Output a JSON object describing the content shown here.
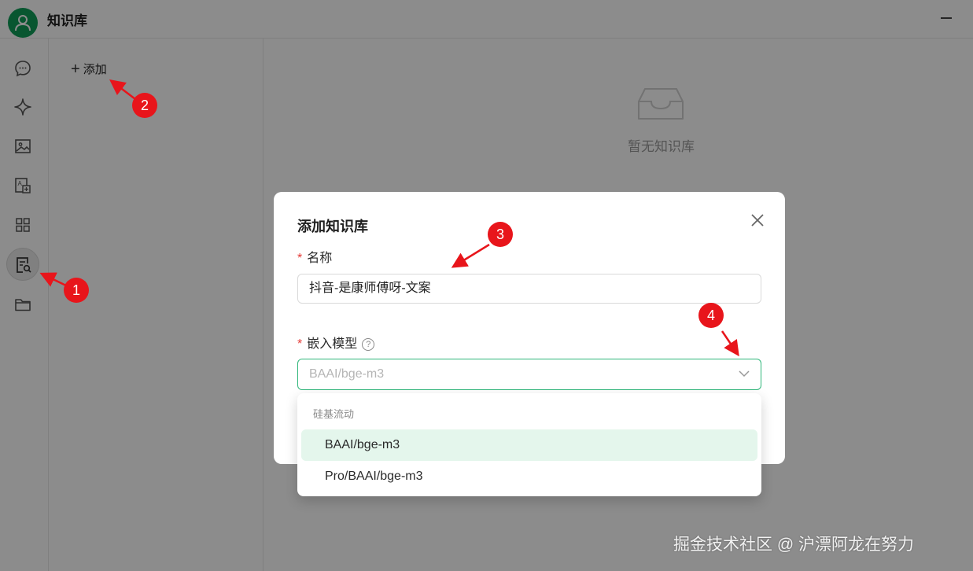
{
  "app": {
    "title": "知识库"
  },
  "rail": {
    "items": [
      {
        "icon": "chat-icon"
      },
      {
        "icon": "sparkle-icon"
      },
      {
        "icon": "image-icon"
      },
      {
        "icon": "translate-icon"
      },
      {
        "icon": "apps-grid-icon"
      },
      {
        "icon": "knowledge-base-icon",
        "active": true
      },
      {
        "icon": "folder-icon"
      }
    ]
  },
  "listpanel": {
    "add_label": "添加"
  },
  "main": {
    "empty_text": "暂无知识库"
  },
  "modal": {
    "title": "添加知识库",
    "name_label": "名称",
    "name_value": "抖音-是康师傅呀-文案",
    "model_label": "嵌入模型",
    "model_placeholder": "BAAI/bge-m3"
  },
  "dropdown": {
    "group": "硅基流动",
    "options": [
      "BAAI/bge-m3",
      "Pro/BAAI/bge-m3"
    ],
    "selected": "BAAI/bge-m3"
  },
  "annotations": {
    "badges": [
      "1",
      "2",
      "3",
      "4"
    ]
  },
  "watermark": "掘金技术社区 @ 沪漂阿龙在努力",
  "colors": {
    "accent": "#2fb67a",
    "badge": "#e8151b",
    "avatar": "#0f9d58"
  }
}
